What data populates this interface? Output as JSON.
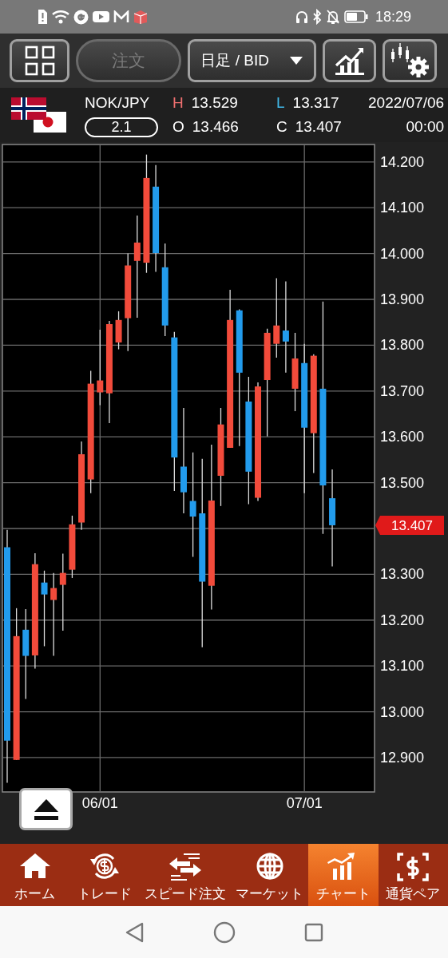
{
  "status_bar": {
    "time": "18:29"
  },
  "toolbar": {
    "order_button": {
      "label": "注文",
      "disabled": true
    },
    "period_select": {
      "value": "日足 / BID"
    }
  },
  "quote": {
    "symbol": "NOK/JPY",
    "spread": "2.1",
    "high_label": "H",
    "high": "13.529",
    "low_label": "L",
    "low": "13.317",
    "open_label": "O",
    "open": "13.466",
    "close_label": "C",
    "close": "13.407",
    "date": "2022/07/06",
    "time": "00:00"
  },
  "chart": {
    "price_tag": "13.407",
    "chart_data": {
      "type": "candlestick",
      "grid": true,
      "ylim": [
        12.825,
        14.238
      ],
      "yticks": [
        {
          "value": 14.2,
          "label": "14.200"
        },
        {
          "value": 14.1,
          "label": "14.100"
        },
        {
          "value": 14.0,
          "label": "14.000"
        },
        {
          "value": 13.9,
          "label": "13.900"
        },
        {
          "value": 13.8,
          "label": "13.800"
        },
        {
          "value": 13.7,
          "label": "13.700"
        },
        {
          "value": 13.6,
          "label": "13.600"
        },
        {
          "value": 13.5,
          "label": "13.500"
        },
        {
          "value": 13.3,
          "label": "13.300"
        },
        {
          "value": 13.2,
          "label": "13.200"
        },
        {
          "value": 13.1,
          "label": "13.100"
        },
        {
          "value": 13.0,
          "label": "13.000"
        },
        {
          "value": 12.9,
          "label": "12.900"
        }
      ],
      "categories": [
        null,
        null,
        null,
        null,
        null,
        null,
        null,
        null,
        null,
        null,
        "06/01",
        null,
        null,
        null,
        null,
        null,
        null,
        null,
        null,
        null,
        null,
        null,
        null,
        null,
        null,
        null,
        null,
        null,
        null,
        null,
        null,
        null,
        "07/01",
        null,
        null,
        null
      ],
      "ohlc": [
        [
          13.359,
          13.397,
          12.845,
          12.937
        ],
        [
          12.895,
          13.226,
          12.895,
          13.165
        ],
        [
          13.179,
          13.224,
          13.028,
          13.122
        ],
        [
          13.123,
          13.346,
          13.094,
          13.322
        ],
        [
          13.282,
          13.308,
          13.143,
          13.256
        ],
        [
          13.244,
          13.303,
          13.122,
          13.27
        ],
        [
          13.277,
          13.345,
          13.177,
          13.303
        ],
        [
          13.31,
          13.428,
          13.292,
          13.409
        ],
        [
          13.413,
          13.59,
          13.397,
          13.562
        ],
        [
          13.507,
          13.744,
          13.477,
          13.716
        ],
        [
          13.697,
          13.834,
          13.669,
          13.723
        ],
        [
          13.695,
          13.853,
          13.63,
          13.846
        ],
        [
          13.806,
          13.874,
          13.791,
          13.855
        ],
        [
          13.859,
          14.0,
          13.787,
          13.974
        ],
        [
          13.984,
          14.083,
          13.86,
          14.024
        ],
        [
          13.98,
          14.216,
          13.958,
          14.165
        ],
        [
          14.146,
          14.193,
          13.96,
          14.001
        ],
        [
          13.97,
          14.022,
          13.82,
          13.843
        ],
        [
          13.817,
          13.829,
          13.482,
          13.555
        ],
        [
          13.535,
          13.663,
          13.433,
          13.479
        ],
        [
          13.46,
          13.566,
          13.338,
          13.426
        ],
        [
          13.433,
          13.552,
          13.141,
          13.284
        ],
        [
          13.275,
          13.583,
          13.223,
          13.461
        ],
        [
          13.515,
          13.663,
          13.449,
          13.627
        ],
        [
          13.576,
          13.921,
          13.576,
          13.855
        ],
        [
          13.876,
          13.878,
          13.58,
          13.74
        ],
        [
          13.677,
          13.731,
          13.453,
          13.524
        ],
        [
          13.467,
          13.719,
          13.46,
          13.71
        ],
        [
          13.724,
          13.836,
          13.601,
          13.827
        ],
        [
          13.803,
          13.946,
          13.773,
          13.843
        ],
        [
          13.832,
          13.939,
          13.74,
          13.808
        ],
        [
          13.705,
          13.827,
          13.656,
          13.771
        ],
        [
          13.761,
          13.803,
          13.477,
          13.62
        ],
        [
          13.608,
          13.78,
          13.521,
          13.777
        ],
        [
          13.705,
          13.895,
          13.388,
          13.494
        ],
        [
          13.466,
          13.529,
          13.317,
          13.407
        ]
      ]
    }
  },
  "nav": {
    "items": [
      {
        "label": "ホーム",
        "selected": false
      },
      {
        "label": "トレード",
        "selected": false
      },
      {
        "label": "スピード注文",
        "selected": false
      },
      {
        "label": "マーケット",
        "selected": false
      },
      {
        "label": "チャート",
        "selected": true
      },
      {
        "label": "通貨ペア",
        "selected": false
      }
    ]
  }
}
